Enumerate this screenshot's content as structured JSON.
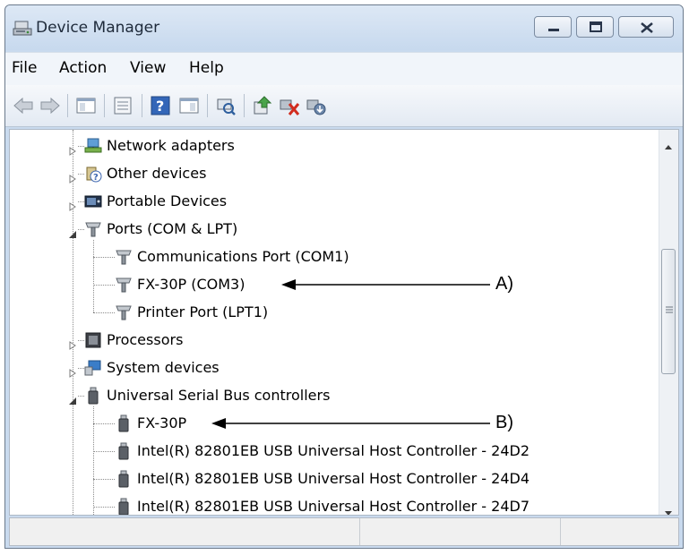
{
  "window": {
    "title": "Device Manager",
    "controls": [
      "minimize-icon",
      "maximize-icon",
      "close-icon"
    ]
  },
  "menu": [
    "File",
    "Action",
    "View",
    "Help"
  ],
  "toolbar": {
    "buttons": [
      "back-arrow-icon",
      "forward-arrow-icon",
      "show-hide-console-tree-icon",
      "properties-icon",
      "help-icon",
      "show-hide-action-pane-icon",
      "scan-hardware-icon",
      "update-driver-icon",
      "uninstall-device-icon",
      "disable-device-icon"
    ]
  },
  "tree": {
    "items": [
      {
        "label": "Network adapters",
        "icon": "network-adapter-icon",
        "state": "collapsed"
      },
      {
        "label": "Other devices",
        "icon": "unknown-device-icon",
        "state": "collapsed"
      },
      {
        "label": "Portable Devices",
        "icon": "portable-device-icon",
        "state": "collapsed"
      },
      {
        "label": "Ports (COM & LPT)",
        "icon": "port-icon",
        "state": "expanded",
        "children": [
          "Communications Port (COM1)",
          "FX-30P (COM3)",
          "Printer Port (LPT1)"
        ]
      },
      {
        "label": "Processors",
        "icon": "processor-icon",
        "state": "collapsed"
      },
      {
        "label": "System devices",
        "icon": "system-device-icon",
        "state": "collapsed"
      },
      {
        "label": "Universal Serial Bus controllers",
        "icon": "usb-icon",
        "state": "expanded",
        "children": [
          "FX-30P",
          "Intel(R) 82801EB USB Universal Host Controller - 24D2",
          "Intel(R) 82801EB USB Universal Host Controller - 24D4",
          "Intel(R) 82801EB USB Universal Host Controller - 24D7"
        ]
      }
    ]
  },
  "callouts": {
    "a": "A)",
    "b": "B)"
  },
  "scrollbar": {
    "position": 0.45
  }
}
